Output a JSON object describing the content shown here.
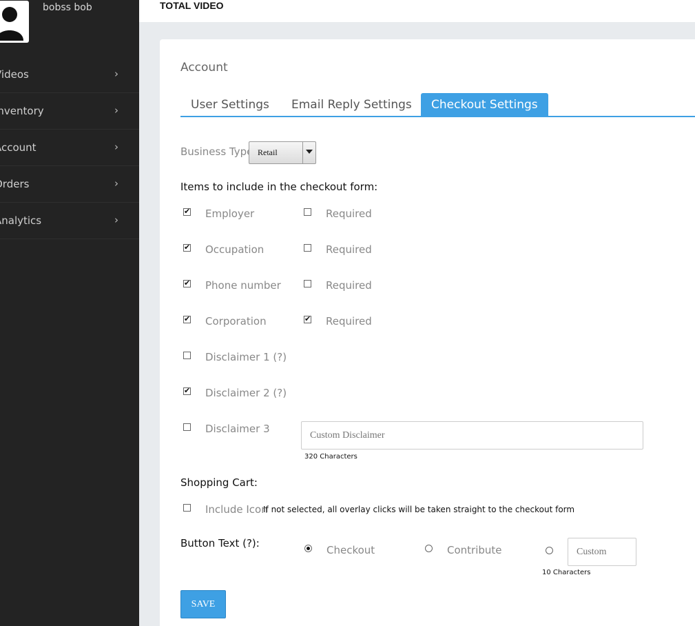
{
  "user": {
    "name": "bobss bob"
  },
  "sidebar": {
    "items": [
      {
        "label": "Videos"
      },
      {
        "label": "Inventory"
      },
      {
        "label": "Account"
      },
      {
        "label": "Orders"
      },
      {
        "label": "Analytics"
      }
    ],
    "chevron": "›"
  },
  "header": {
    "title": "TOTAL VIDEO"
  },
  "main": {
    "section_title": "Account",
    "tabs": [
      {
        "label": "User Settings",
        "active": false
      },
      {
        "label": "Email Reply Settings",
        "active": false
      },
      {
        "label": "Checkout Settings",
        "active": true
      }
    ],
    "business_type": {
      "label": "Business Type",
      "value": "Retail"
    },
    "items_heading": "Items to include in the checkout form:",
    "items": [
      {
        "label": "Employer",
        "checked": true,
        "required_label": "Required",
        "required": false
      },
      {
        "label": "Occupation",
        "checked": true,
        "required_label": "Required",
        "required": false
      },
      {
        "label": "Phone number",
        "checked": true,
        "required_label": "Required",
        "required": false
      },
      {
        "label": "Corporation",
        "checked": true,
        "required_label": "Required",
        "required": true
      },
      {
        "label": "Disclaimer 1 (?)",
        "checked": false
      },
      {
        "label": "Disclaimer 2 (?)",
        "checked": true
      },
      {
        "label": "Disclaimer 3",
        "checked": false
      }
    ],
    "custom_disclaimer": {
      "placeholder": "Custom Disclaimer",
      "counter": "320 Characters"
    },
    "shopping_cart": {
      "heading": "Shopping Cart:",
      "include_icon_label": "Include Icon",
      "include_icon_checked": false,
      "note": "If not selected, all overlay clicks will be taken straight to the checkout form"
    },
    "button_text": {
      "heading": "Button Text (?):",
      "options": [
        {
          "label": "Checkout",
          "selected": true
        },
        {
          "label": "Contribute",
          "selected": false
        }
      ],
      "custom_placeholder": "Custom",
      "custom_selected": false,
      "counter": "10 Characters"
    },
    "save_label": "SAVE"
  },
  "colors": {
    "accent": "#3ea0e4",
    "sidebar_bg": "#232323",
    "page_bg": "#e8ebee"
  },
  "icons": {
    "avatar": "user-silhouette-icon",
    "chevron": "chevron-right-icon",
    "dropdown": "caret-down-icon"
  }
}
